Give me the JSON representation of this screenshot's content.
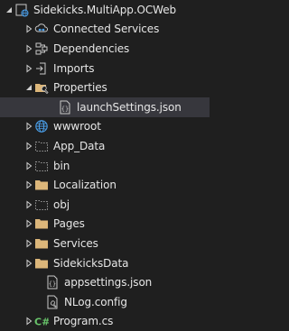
{
  "tree": {
    "project": {
      "label": "Sidekicks.MultiApp.OCWeb",
      "icon": "web-project-icon",
      "expanded": true
    },
    "items": [
      {
        "label": "Connected Services",
        "icon": "connected-services-icon",
        "expanded": false
      },
      {
        "label": "Dependencies",
        "icon": "dependencies-icon",
        "expanded": false
      },
      {
        "label": "Imports",
        "icon": "imports-icon",
        "expanded": false
      },
      {
        "label": "Properties",
        "icon": "properties-folder-icon",
        "expanded": true,
        "children": [
          {
            "label": "launchSettings.json",
            "icon": "json-file-icon"
          }
        ]
      },
      {
        "label": "wwwroot",
        "icon": "globe-icon",
        "expanded": false
      },
      {
        "label": "App_Data",
        "icon": "dashed-folder-icon",
        "expanded": false
      },
      {
        "label": "bin",
        "icon": "dashed-folder-icon",
        "expanded": false
      },
      {
        "label": "Localization",
        "icon": "folder-icon",
        "expanded": false
      },
      {
        "label": "obj",
        "icon": "dashed-folder-icon",
        "expanded": false
      },
      {
        "label": "Pages",
        "icon": "folder-icon",
        "expanded": false
      },
      {
        "label": "Services",
        "icon": "folder-icon",
        "expanded": false
      },
      {
        "label": "SidekicksData",
        "icon": "folder-icon",
        "expanded": false
      },
      {
        "label": "appsettings.json",
        "icon": "json-file-icon"
      },
      {
        "label": "NLog.config",
        "icon": "config-file-icon"
      },
      {
        "label": "Program.cs",
        "icon": "csharp-file-icon",
        "expanded": false
      }
    ]
  },
  "colors": {
    "background": "#1f1f1f",
    "text": "#e6e6e6",
    "selected_row": "#37373d",
    "folder": "#dcb67a",
    "accent_blue": "#4a9ee8",
    "csharp_green": "#68c36a"
  }
}
